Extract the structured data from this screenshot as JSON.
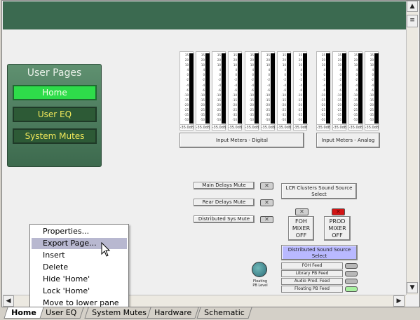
{
  "user_pages": {
    "title": "User Pages",
    "items": [
      {
        "label": "Home",
        "active": true
      },
      {
        "label": "User EQ",
        "active": false
      },
      {
        "label": "System Mutes",
        "active": false
      }
    ]
  },
  "meters": {
    "scale_labels": [
      "35",
      "20",
      "10",
      "4",
      "0",
      "-2",
      "-4",
      "-6",
      "-10",
      "-15",
      "-20",
      "-25",
      "-35",
      "-50"
    ],
    "readout": "-35.0dB",
    "digital_label": "Input Meters - Digital",
    "analog_label": "Input Meters - Analog"
  },
  "mutes": {
    "main_delays": "Main Delays Mute",
    "rear_delays": "Rear Delays Mute",
    "distributed_sys": "Distributed Sys Mute",
    "led_symbol": "✕"
  },
  "lcr_select": {
    "line1": "LCR Clusters Sound Source",
    "line2": "Select"
  },
  "foh_mixer": {
    "line1": "FOH",
    "line2": "MIXER",
    "line3": "OFF"
  },
  "prod_mixer": {
    "line1": "PROD",
    "line2": "MIXER",
    "line3": "OFF"
  },
  "distributed_select": {
    "line1": "Distributed Sound Source",
    "line2": "Select"
  },
  "feeds": [
    "FOH Feed",
    "Library PB Feed",
    "Audio Prod. Feed",
    "Floating PB Feed"
  ],
  "floating_knob": {
    "line1": "Floating",
    "line2": "PB Level"
  },
  "context_menu": {
    "items": [
      "Properties...",
      "Export Page...",
      "Insert",
      "Delete",
      "Hide 'Home'",
      "Lock 'Home'",
      "Move  to lower pane"
    ],
    "highlighted_index": 1
  },
  "tabs": [
    "Home",
    "User EQ",
    "System Mutes",
    "Hardware",
    "Schematic"
  ],
  "colors": {
    "header_green": "#3b6a50",
    "nav_active": "#2edc4a",
    "nav_inactive": "#2d5a36",
    "nav_text_inactive": "#f0e85a",
    "led_red": "#d11414",
    "led_green": "#a8f0a0",
    "select_blue": "#b9b9ff"
  }
}
